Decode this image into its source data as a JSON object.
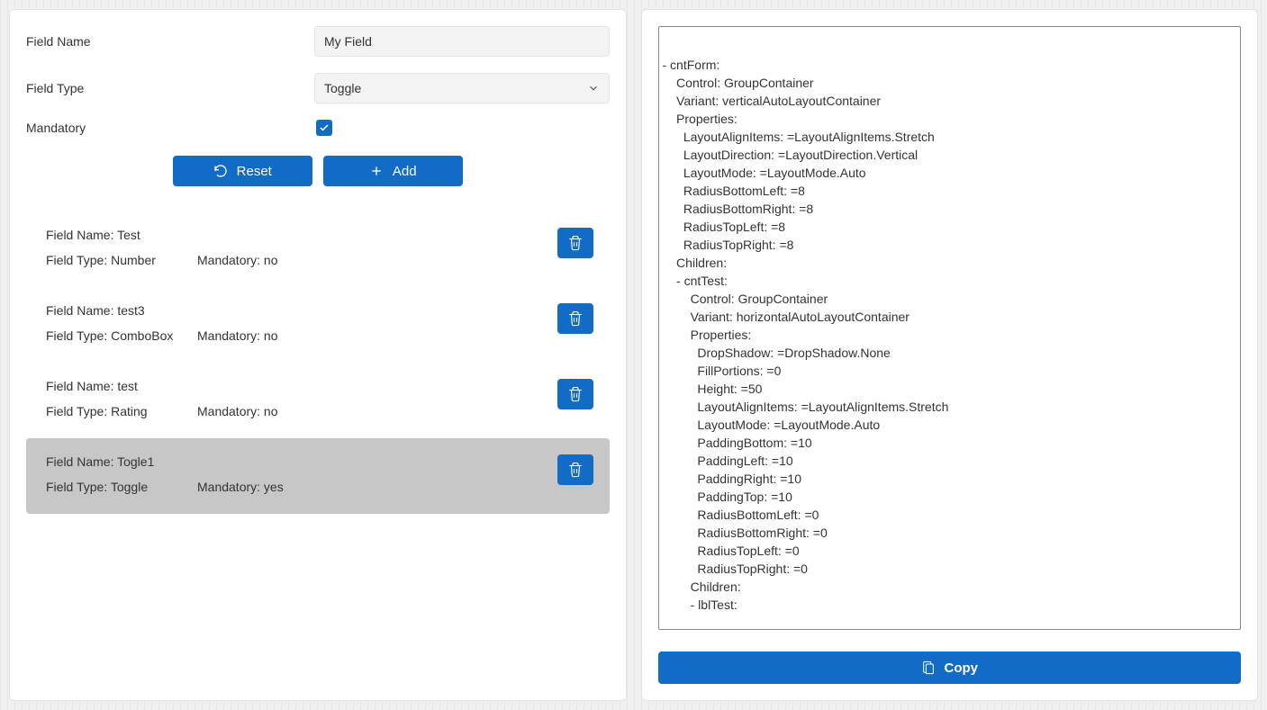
{
  "form": {
    "fieldName_label": "Field Name",
    "fieldName_value": "My Field",
    "fieldType_label": "Field Type",
    "fieldType_value": "Toggle",
    "mandatory_label": "Mandatory",
    "mandatory_checked": true,
    "reset_label": "Reset",
    "add_label": "Add"
  },
  "fields": [
    {
      "name_label": "Field Name: Test",
      "type_label": "Field Type: Number",
      "mand_label": "Mandatory: no",
      "selected": false
    },
    {
      "name_label": "Field Name: test3",
      "type_label": "Field Type: ComboBox",
      "mand_label": "Mandatory: no",
      "selected": false
    },
    {
      "name_label": "Field Name: test",
      "type_label": "Field Type: Rating",
      "mand_label": "Mandatory: no",
      "selected": false
    },
    {
      "name_label": "Field Name: Togle1",
      "type_label": "Field Type: Toggle",
      "mand_label": "Mandatory: yes",
      "selected": true
    }
  ],
  "output": {
    "copy_label": "Copy",
    "yaml": "\n- cntForm:\n    Control: GroupContainer\n    Variant: verticalAutoLayoutContainer\n    Properties:\n      LayoutAlignItems: =LayoutAlignItems.Stretch\n      LayoutDirection: =LayoutDirection.Vertical\n      LayoutMode: =LayoutMode.Auto\n      RadiusBottomLeft: =8\n      RadiusBottomRight: =8\n      RadiusTopLeft: =8\n      RadiusTopRight: =8\n    Children:\n    - cntTest:\n        Control: GroupContainer\n        Variant: horizontalAutoLayoutContainer\n        Properties:\n          DropShadow: =DropShadow.None\n          FillPortions: =0\n          Height: =50\n          LayoutAlignItems: =LayoutAlignItems.Stretch\n          LayoutMode: =LayoutMode.Auto\n          PaddingBottom: =10\n          PaddingLeft: =10\n          PaddingRight: =10\n          PaddingTop: =10\n          RadiusBottomLeft: =0\n          RadiusBottomRight: =0\n          RadiusTopLeft: =0\n          RadiusTopRight: =0\n        Children:\n        - lblTest:\n"
  }
}
